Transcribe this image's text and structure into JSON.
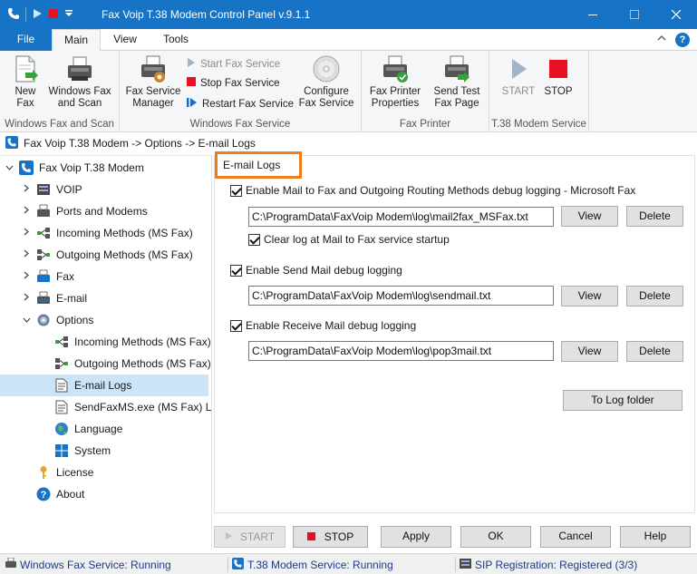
{
  "window": {
    "title": "Fax Voip T.38 Modem Control Panel v.9.1.1"
  },
  "menu_tabs": {
    "file": "File",
    "main": "Main",
    "view": "View",
    "tools": "Tools"
  },
  "ribbon": {
    "groups": {
      "windows_fax": "Windows Fax and Scan",
      "windows_fax_service": "Windows Fax Service",
      "fax_printer": "Fax Printer",
      "t38_service": "T.38 Modem Service"
    },
    "new_fax": "New\nFax",
    "windows_fax_scan": "Windows Fax\nand Scan",
    "fax_service_manager": "Fax Service\nManager",
    "start_fax_service": "Start Fax Service",
    "stop_fax_service": "Stop Fax Service",
    "restart_fax_service": "Restart Fax Service",
    "configure_fax_service": "Configure\nFax Service",
    "fax_printer_properties": "Fax Printer\nProperties",
    "send_test_fax_page": "Send Test\nFax Page",
    "start": "START",
    "stop": "STOP"
  },
  "breadcrumb": "Fax Voip T.38 Modem -> Options -> E-mail Logs",
  "tree": [
    {
      "label": "Fax Voip T.38 Modem",
      "level": 0,
      "expanded": true
    },
    {
      "label": "VOIP",
      "level": 1
    },
    {
      "label": "Ports and Modems",
      "level": 1
    },
    {
      "label": "Incoming Methods (MS Fax)",
      "level": 1
    },
    {
      "label": "Outgoing Methods (MS Fax)",
      "level": 1
    },
    {
      "label": "Fax",
      "level": 1
    },
    {
      "label": "E-mail",
      "level": 1
    },
    {
      "label": "Options",
      "level": 1,
      "expanded": true
    },
    {
      "label": "Incoming Methods (MS Fax)",
      "level": 2
    },
    {
      "label": "Outgoing Methods (MS Fax)",
      "level": 2
    },
    {
      "label": "E-mail Logs",
      "level": 2,
      "selected": true
    },
    {
      "label": "SendFaxMS.exe (MS Fax) Log",
      "level": 2
    },
    {
      "label": "Language",
      "level": 2
    },
    {
      "label": "System",
      "level": 2
    },
    {
      "label": "License",
      "level": 1
    },
    {
      "label": "About",
      "level": 1
    }
  ],
  "panel": {
    "title": "E-mail Logs",
    "mail2fax": {
      "label": "Enable Mail to Fax and Outgoing Routing Methods debug logging - Microsoft Fax",
      "path": "C:\\ProgramData\\FaxVoip Modem\\log\\mail2fax_MSFax.txt",
      "clear_label": "Clear log at Mail to Fax service startup"
    },
    "sendmail": {
      "label": "Enable Send Mail debug logging",
      "path": "C:\\ProgramData\\FaxVoip Modem\\log\\sendmail.txt"
    },
    "receive": {
      "label": "Enable Receive Mail debug logging",
      "path": "C:\\ProgramData\\FaxVoip Modem\\log\\pop3mail.txt"
    },
    "view": "View",
    "delete": "Delete",
    "log_folder": "To Log folder"
  },
  "bottom_buttons": {
    "start": "START",
    "stop": "STOP",
    "apply": "Apply",
    "ok": "OK",
    "cancel": "Cancel",
    "help": "Help"
  },
  "status": {
    "windows_fax": "Windows Fax Service: Running",
    "t38": "T.38 Modem Service: Running",
    "sip": "SIP Registration: Registered (3/3)"
  },
  "colors": {
    "accent": "#1673c6",
    "highlight": "#ef7d1a",
    "selection": "#cce4f7",
    "stop_red": "#e81123"
  }
}
